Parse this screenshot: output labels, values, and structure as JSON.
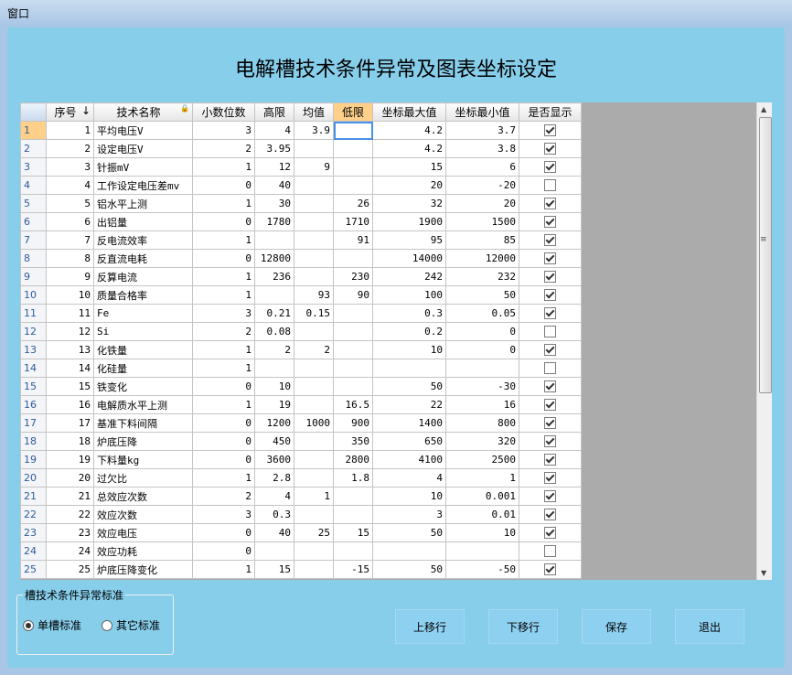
{
  "window": {
    "title": "窗口"
  },
  "page": {
    "title": "电解槽技术条件异常及图表坐标设定"
  },
  "grid": {
    "columns": [
      "序号",
      "↓",
      "技术名称",
      "🔒",
      "小数位数",
      "高限",
      "均值",
      "低限",
      "坐标最大值",
      "坐标最小值",
      "是否显示"
    ],
    "rows": [
      [
        "1",
        "1",
        "平均电压V",
        "3",
        "4",
        "3.9",
        "",
        "4.2",
        "3.7",
        true
      ],
      [
        "2",
        "2",
        "设定电压V",
        "2",
        "3.95",
        "",
        "",
        "4.2",
        "3.8",
        true
      ],
      [
        "3",
        "3",
        "针振mV",
        "1",
        "12",
        "9",
        "",
        "15",
        "6",
        true
      ],
      [
        "4",
        "4",
        "工作设定电压差mv",
        "0",
        "40",
        "",
        "",
        "20",
        "-20",
        false
      ],
      [
        "5",
        "5",
        "铝水平上测",
        "1",
        "30",
        "",
        "26",
        "32",
        "20",
        true
      ],
      [
        "6",
        "6",
        "出铝量",
        "0",
        "1780",
        "",
        "1710",
        "1900",
        "1500",
        true
      ],
      [
        "7",
        "7",
        "反电流效率",
        "1",
        "",
        "",
        "91",
        "95",
        "85",
        true
      ],
      [
        "8",
        "8",
        "反直流电耗",
        "0",
        "12800",
        "",
        "",
        "14000",
        "12000",
        true
      ],
      [
        "9",
        "9",
        "反算电流",
        "1",
        "236",
        "",
        "230",
        "242",
        "232",
        true
      ],
      [
        "10",
        "10",
        "质量合格率",
        "1",
        "",
        "93",
        "90",
        "100",
        "50",
        true
      ],
      [
        "11",
        "11",
        "Fe",
        "3",
        "0.21",
        "0.15",
        "",
        "0.3",
        "0.05",
        true
      ],
      [
        "12",
        "12",
        "Si",
        "2",
        "0.08",
        "",
        "",
        "0.2",
        "0",
        false
      ],
      [
        "13",
        "13",
        "化铁量",
        "1",
        "2",
        "2",
        "",
        "10",
        "0",
        true
      ],
      [
        "14",
        "14",
        "化硅量",
        "1",
        "",
        "",
        "",
        "",
        "",
        false
      ],
      [
        "15",
        "15",
        "铁变化",
        "0",
        "10",
        "",
        "",
        "50",
        "-30",
        true
      ],
      [
        "16",
        "16",
        "电解质水平上测",
        "1",
        "19",
        "",
        "16.5",
        "22",
        "16",
        true
      ],
      [
        "17",
        "17",
        "基准下料间隔",
        "0",
        "1200",
        "1000",
        "900",
        "1400",
        "800",
        true
      ],
      [
        "18",
        "18",
        "炉底压降",
        "0",
        "450",
        "",
        "350",
        "650",
        "320",
        true
      ],
      [
        "19",
        "19",
        "下料量kg",
        "0",
        "3600",
        "",
        "2800",
        "4100",
        "2500",
        true
      ],
      [
        "20",
        "20",
        "过欠比",
        "1",
        "2.8",
        "",
        "1.8",
        "4",
        "1",
        true
      ],
      [
        "21",
        "21",
        "总效应次数",
        "2",
        "4",
        "1",
        "",
        "10",
        "0.001",
        true
      ],
      [
        "22",
        "22",
        "效应次数",
        "3",
        "0.3",
        "",
        "",
        "3",
        "0.01",
        true
      ],
      [
        "23",
        "23",
        "效应电压",
        "0",
        "40",
        "25",
        "15",
        "50",
        "10",
        true
      ],
      [
        "24",
        "24",
        "效应功耗",
        "0",
        "",
        "",
        "",
        "",
        "",
        false
      ],
      [
        "25",
        "25",
        "炉底压降变化",
        "1",
        "15",
        "",
        "-15",
        "50",
        "-50",
        true
      ]
    ]
  },
  "groupbox": {
    "label": "槽技术条件异常标准",
    "option1": "单槽标准",
    "option2": "其它标准",
    "selected": "单槽标准"
  },
  "buttons": {
    "move_up": "上移行",
    "move_down": "下移行",
    "save": "保存",
    "exit": "退出"
  },
  "colors": {
    "background": "#87ceeb",
    "header_highlight": "#ffd08a",
    "button": "#8ed0f0"
  }
}
